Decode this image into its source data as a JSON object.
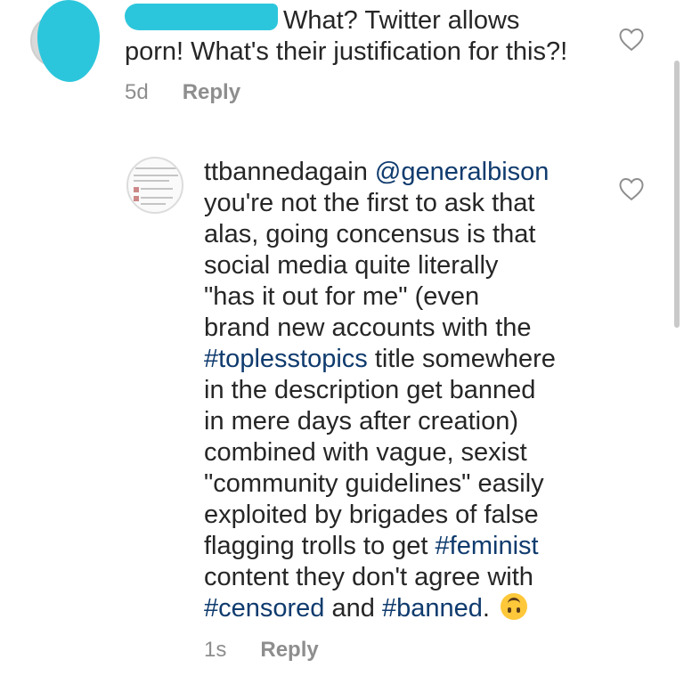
{
  "comment1": {
    "text_line1": "What? Twitter allows",
    "text_line2": "porn! What's their justification for this?!",
    "time": "5d",
    "reply_label": "Reply"
  },
  "comment2": {
    "username": "ttbannedagain",
    "mention": "@generalbison",
    "lines": [
      "you're not the first to ask that",
      "alas, going concensus is that",
      "social media quite literally",
      "\"has it out for me\" (even",
      "brand new accounts with the"
    ],
    "tag_toplesstopics": "#toplesstopics",
    "after_tag_line": " title somewhere",
    "lines_b": [
      "in the description get banned",
      "in mere days after creation)",
      "combined with vague, sexist",
      "\"community guidelines\" easily",
      "exploited by brigades of false"
    ],
    "flagging_prefix": "flagging trolls to get ",
    "tag_feminist": "#feminist",
    "line_content": "content they don't agree with",
    "tag_censored": "#censored",
    "and_text": " and ",
    "tag_banned": "#banned",
    "period": ".",
    "emoji": "upside-down-face",
    "time": "1s",
    "reply_label": "Reply"
  },
  "colors": {
    "hashtag": "#0f3b6e",
    "meta": "#8e8e8e",
    "redaction": "#2cc6dc"
  }
}
